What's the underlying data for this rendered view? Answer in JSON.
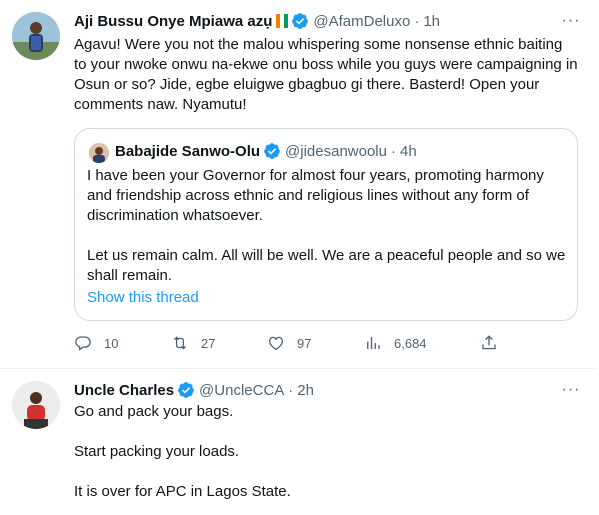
{
  "tweet1": {
    "author_name": "Aji Bussu Onye Mpiawa azụ",
    "handle": "@AfamDeluxo",
    "dot": "·",
    "time": "1h",
    "text": "Agavu! Were you not the malou whispering some nonsense ethnic baiting to your nwoke onwu na-ekwe onu boss while you guys were campaigning in Osun or so?  Jide, egbe eluigwe gbagbuo gi there.  Basterd! Open your comments naw.  Nyamutu!",
    "quote": {
      "author_name": "Babajide Sanwo-Olu",
      "handle": "@jidesanwoolu",
      "dot": "·",
      "time": "4h",
      "paragraph1": "I have been your Governor for almost four years, promoting harmony and friendship across ethnic and religious lines without any form of discrimination whatsoever.",
      "paragraph2": "Let us remain calm. All will be well. We are a peaceful people and so we shall remain.",
      "show_thread": "Show this thread"
    },
    "actions": {
      "replies": "10",
      "retweets": "27",
      "likes": "97",
      "views": "6,684"
    }
  },
  "tweet2": {
    "author_name": "Uncle Charles",
    "handle": "@UncleCCA",
    "dot": "·",
    "time": "2h",
    "line1": "Go and pack your bags.",
    "line2": "Start packing your loads.",
    "line3": "It is over for APC in Lagos State."
  },
  "colors": {
    "verified": "#1d9bf0",
    "link": "#1d9bf0",
    "muted": "#536471",
    "border": "#cfd9de"
  },
  "icons": [
    "more-icon",
    "verified-badge-icon",
    "flag-icon",
    "reply-icon",
    "retweet-icon",
    "like-icon",
    "views-icon",
    "share-icon"
  ]
}
